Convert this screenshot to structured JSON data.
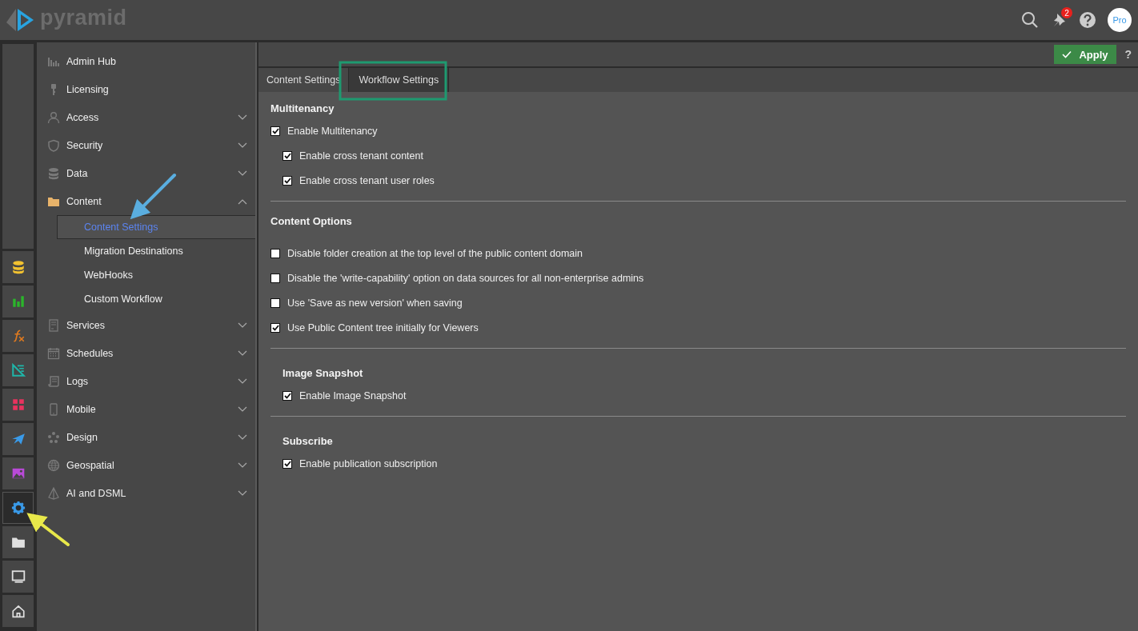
{
  "header": {
    "logo_text": "pyramid",
    "notification_count": "2",
    "avatar_text": "Pro"
  },
  "rail": [
    {
      "kind": "database",
      "selected": false
    },
    {
      "kind": "chart",
      "selected": false
    },
    {
      "kind": "formula",
      "selected": false
    },
    {
      "kind": "ruler",
      "selected": false
    },
    {
      "kind": "tiles",
      "selected": false
    },
    {
      "kind": "plane",
      "selected": false
    },
    {
      "kind": "image",
      "selected": false
    },
    {
      "kind": "gear",
      "selected": true
    },
    {
      "kind": "folder",
      "selected": false
    },
    {
      "kind": "monitor",
      "selected": false
    },
    {
      "kind": "home",
      "selected": false
    }
  ],
  "sidebar": {
    "items": [
      {
        "kind": "link",
        "label": "Admin Hub"
      },
      {
        "kind": "link",
        "label": "Licensing"
      },
      {
        "kind": "group",
        "label": "Access",
        "expanded": false
      },
      {
        "kind": "group",
        "label": "Security",
        "expanded": false
      },
      {
        "kind": "group",
        "label": "Data",
        "expanded": false
      },
      {
        "kind": "group",
        "label": "Content",
        "expanded": true,
        "children": [
          {
            "label": "Content Settings",
            "selected": true
          },
          {
            "label": "Migration Destinations",
            "selected": false
          },
          {
            "label": "WebHooks",
            "selected": false
          },
          {
            "label": "Custom Workflow",
            "selected": false
          }
        ]
      },
      {
        "kind": "group",
        "label": "Services",
        "expanded": false
      },
      {
        "kind": "group",
        "label": "Schedules",
        "expanded": false
      },
      {
        "kind": "group",
        "label": "Logs",
        "expanded": false
      },
      {
        "kind": "group",
        "label": "Mobile",
        "expanded": false
      },
      {
        "kind": "group",
        "label": "Design",
        "expanded": false
      },
      {
        "kind": "group",
        "label": "Geospatial",
        "expanded": false
      },
      {
        "kind": "group",
        "label": "AI and DSML",
        "expanded": false
      }
    ]
  },
  "toolbar": {
    "apply_label": "Apply",
    "help_label": "?"
  },
  "tabs": [
    {
      "label": "Content Settings",
      "selected": false
    },
    {
      "label": "Workflow Settings",
      "selected": true
    }
  ],
  "sections": [
    {
      "title": "Multitenancy",
      "indented": false,
      "options": [
        {
          "label": "Enable Multitenancy",
          "checked": true,
          "children": [
            {
              "label": "Enable cross tenant content",
              "checked": true
            },
            {
              "label": "Enable cross tenant user roles",
              "checked": true
            }
          ]
        }
      ]
    },
    {
      "title": "Content Options",
      "indented": false,
      "options": [
        {
          "label": "Disable folder creation at the top level of the public content domain",
          "checked": false
        },
        {
          "label": "Disable the 'write-capability' option on data sources for all non-enterprise admins",
          "checked": false
        },
        {
          "label": "Use 'Save as new version' when saving",
          "checked": false
        },
        {
          "label": "Use Public Content tree initially for Viewers",
          "checked": true
        }
      ]
    },
    {
      "title": "Image Snapshot",
      "indented": true,
      "options": [
        {
          "label": "Enable Image Snapshot",
          "checked": true
        }
      ]
    },
    {
      "title": "Subscribe",
      "indented": true,
      "options": [
        {
          "label": "Enable publication subscription",
          "checked": true
        }
      ]
    }
  ]
}
